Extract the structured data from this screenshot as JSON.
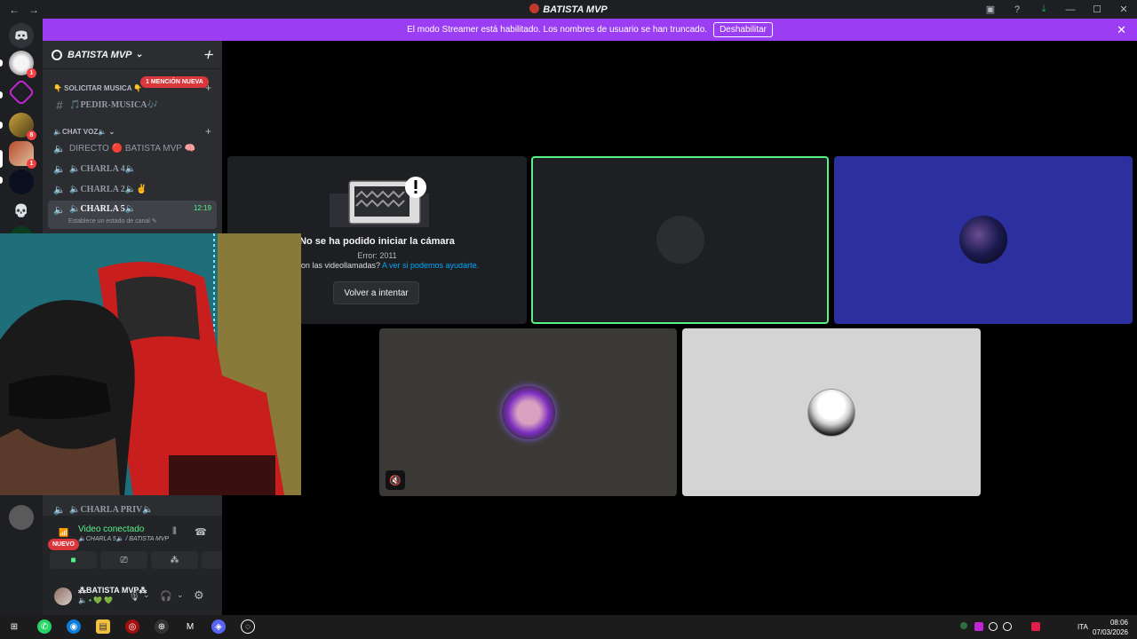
{
  "window": {
    "title": "BATISTA MVP",
    "back": "←",
    "forward": "→",
    "controls": [
      "▣",
      "?",
      "⤓",
      "—",
      "☐",
      "✕"
    ]
  },
  "banner": {
    "text": "El modo Streamer está habilitado. Los nombres de usuario se han truncado.",
    "button": "Deshabilitar",
    "close": "✕"
  },
  "guild_badges": [
    "1",
    "8",
    "1"
  ],
  "server": {
    "name": "BATISTA MVP",
    "chevron": "⌄",
    "add_icon": "＋"
  },
  "categories": [
    {
      "label": "👇 SOLICITAR MUSICA 👇",
      "plus": "+"
    },
    {
      "label": "🔈CHAT VOZ🔈 ⌄",
      "plus": "+"
    }
  ],
  "mention_badge": "1 MENCIÓN NUEVA",
  "new_badge": "NUEVO",
  "channels": {
    "pedir": {
      "icon": "#",
      "name": "🎵PEDIR-MUSICA🎶"
    },
    "directo": {
      "icon": "🔈",
      "name": "DIRECTO 🔴 BATISTA MVP 🧠"
    },
    "charla4": {
      "icon": "🔈",
      "name": "🔈CHARLA 4🔈"
    },
    "charla2": {
      "icon": "🔈",
      "name": "🔈CHARLA 2🔈✌"
    },
    "charla5": {
      "icon": "🔈",
      "name": "🔈CHARLA 5🔈",
      "time": "12:19",
      "status": "Establece un estado de canal ✎"
    },
    "charlapriv": {
      "icon": "🔈",
      "name": "🔈CHARLA PRIV🔈"
    }
  },
  "voice_panel": {
    "status": "Video conectado",
    "location": "🔈CHARLA 5🔈 / BATISTA MVP",
    "signal_icon": "📶",
    "noise_icon": "⦀",
    "disconnect_icon": "☎",
    "buttons": [
      "■",
      "⎚",
      "⁂",
      "✦"
    ]
  },
  "user": {
    "name": "⁂BATISTA MVP⁂",
    "status": "🔈 • 💚 💚",
    "mic_icon": "🎙",
    "headset_icon": "🎧",
    "settings_icon": "⚙",
    "chevron": "⌄"
  },
  "camera_error": {
    "title": "No se ha podido iniciar la cámara",
    "code": "Error: 2011",
    "help_prefix": "emas con las videollamadas?",
    "help_link": "A ver si podemos ayudarte.",
    "retry": "Volver a intentar"
  },
  "tile_mute_icon": "🔇",
  "taskbar": {
    "apps": [
      "⊞",
      "✆",
      "◉",
      "▤",
      "◎",
      "⊕",
      "M",
      "◈",
      "◌"
    ],
    "tray": [
      "ITA"
    ],
    "time": "08:06",
    "date": "07/03/2026"
  },
  "colors": {
    "banner": "#9b3ef3",
    "speaking": "#57f287",
    "sidebar": "#2b2d31",
    "guilds": "#1e1f22"
  }
}
